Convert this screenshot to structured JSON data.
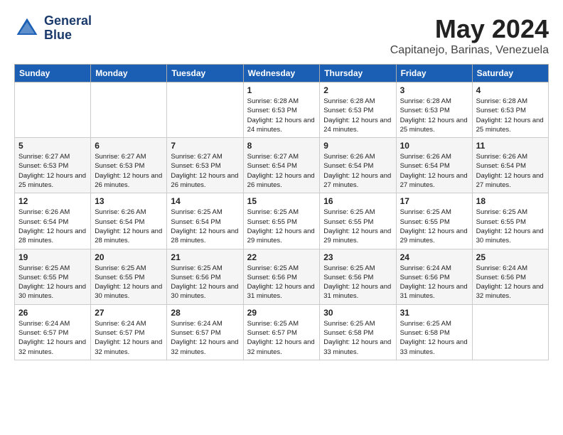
{
  "logo": {
    "line1": "General",
    "line2": "Blue"
  },
  "title": "May 2024",
  "location": "Capitanejo, Barinas, Venezuela",
  "weekdays": [
    "Sunday",
    "Monday",
    "Tuesday",
    "Wednesday",
    "Thursday",
    "Friday",
    "Saturday"
  ],
  "weeks": [
    [
      {
        "day": "",
        "sunrise": "",
        "sunset": "",
        "daylight": ""
      },
      {
        "day": "",
        "sunrise": "",
        "sunset": "",
        "daylight": ""
      },
      {
        "day": "",
        "sunrise": "",
        "sunset": "",
        "daylight": ""
      },
      {
        "day": "1",
        "sunrise": "Sunrise: 6:28 AM",
        "sunset": "Sunset: 6:53 PM",
        "daylight": "Daylight: 12 hours and 24 minutes."
      },
      {
        "day": "2",
        "sunrise": "Sunrise: 6:28 AM",
        "sunset": "Sunset: 6:53 PM",
        "daylight": "Daylight: 12 hours and 24 minutes."
      },
      {
        "day": "3",
        "sunrise": "Sunrise: 6:28 AM",
        "sunset": "Sunset: 6:53 PM",
        "daylight": "Daylight: 12 hours and 25 minutes."
      },
      {
        "day": "4",
        "sunrise": "Sunrise: 6:28 AM",
        "sunset": "Sunset: 6:53 PM",
        "daylight": "Daylight: 12 hours and 25 minutes."
      }
    ],
    [
      {
        "day": "5",
        "sunrise": "Sunrise: 6:27 AM",
        "sunset": "Sunset: 6:53 PM",
        "daylight": "Daylight: 12 hours and 25 minutes."
      },
      {
        "day": "6",
        "sunrise": "Sunrise: 6:27 AM",
        "sunset": "Sunset: 6:53 PM",
        "daylight": "Daylight: 12 hours and 26 minutes."
      },
      {
        "day": "7",
        "sunrise": "Sunrise: 6:27 AM",
        "sunset": "Sunset: 6:53 PM",
        "daylight": "Daylight: 12 hours and 26 minutes."
      },
      {
        "day": "8",
        "sunrise": "Sunrise: 6:27 AM",
        "sunset": "Sunset: 6:54 PM",
        "daylight": "Daylight: 12 hours and 26 minutes."
      },
      {
        "day": "9",
        "sunrise": "Sunrise: 6:26 AM",
        "sunset": "Sunset: 6:54 PM",
        "daylight": "Daylight: 12 hours and 27 minutes."
      },
      {
        "day": "10",
        "sunrise": "Sunrise: 6:26 AM",
        "sunset": "Sunset: 6:54 PM",
        "daylight": "Daylight: 12 hours and 27 minutes."
      },
      {
        "day": "11",
        "sunrise": "Sunrise: 6:26 AM",
        "sunset": "Sunset: 6:54 PM",
        "daylight": "Daylight: 12 hours and 27 minutes."
      }
    ],
    [
      {
        "day": "12",
        "sunrise": "Sunrise: 6:26 AM",
        "sunset": "Sunset: 6:54 PM",
        "daylight": "Daylight: 12 hours and 28 minutes."
      },
      {
        "day": "13",
        "sunrise": "Sunrise: 6:26 AM",
        "sunset": "Sunset: 6:54 PM",
        "daylight": "Daylight: 12 hours and 28 minutes."
      },
      {
        "day": "14",
        "sunrise": "Sunrise: 6:25 AM",
        "sunset": "Sunset: 6:54 PM",
        "daylight": "Daylight: 12 hours and 28 minutes."
      },
      {
        "day": "15",
        "sunrise": "Sunrise: 6:25 AM",
        "sunset": "Sunset: 6:55 PM",
        "daylight": "Daylight: 12 hours and 29 minutes."
      },
      {
        "day": "16",
        "sunrise": "Sunrise: 6:25 AM",
        "sunset": "Sunset: 6:55 PM",
        "daylight": "Daylight: 12 hours and 29 minutes."
      },
      {
        "day": "17",
        "sunrise": "Sunrise: 6:25 AM",
        "sunset": "Sunset: 6:55 PM",
        "daylight": "Daylight: 12 hours and 29 minutes."
      },
      {
        "day": "18",
        "sunrise": "Sunrise: 6:25 AM",
        "sunset": "Sunset: 6:55 PM",
        "daylight": "Daylight: 12 hours and 30 minutes."
      }
    ],
    [
      {
        "day": "19",
        "sunrise": "Sunrise: 6:25 AM",
        "sunset": "Sunset: 6:55 PM",
        "daylight": "Daylight: 12 hours and 30 minutes."
      },
      {
        "day": "20",
        "sunrise": "Sunrise: 6:25 AM",
        "sunset": "Sunset: 6:55 PM",
        "daylight": "Daylight: 12 hours and 30 minutes."
      },
      {
        "day": "21",
        "sunrise": "Sunrise: 6:25 AM",
        "sunset": "Sunset: 6:56 PM",
        "daylight": "Daylight: 12 hours and 30 minutes."
      },
      {
        "day": "22",
        "sunrise": "Sunrise: 6:25 AM",
        "sunset": "Sunset: 6:56 PM",
        "daylight": "Daylight: 12 hours and 31 minutes."
      },
      {
        "day": "23",
        "sunrise": "Sunrise: 6:25 AM",
        "sunset": "Sunset: 6:56 PM",
        "daylight": "Daylight: 12 hours and 31 minutes."
      },
      {
        "day": "24",
        "sunrise": "Sunrise: 6:24 AM",
        "sunset": "Sunset: 6:56 PM",
        "daylight": "Daylight: 12 hours and 31 minutes."
      },
      {
        "day": "25",
        "sunrise": "Sunrise: 6:24 AM",
        "sunset": "Sunset: 6:56 PM",
        "daylight": "Daylight: 12 hours and 32 minutes."
      }
    ],
    [
      {
        "day": "26",
        "sunrise": "Sunrise: 6:24 AM",
        "sunset": "Sunset: 6:57 PM",
        "daylight": "Daylight: 12 hours and 32 minutes."
      },
      {
        "day": "27",
        "sunrise": "Sunrise: 6:24 AM",
        "sunset": "Sunset: 6:57 PM",
        "daylight": "Daylight: 12 hours and 32 minutes."
      },
      {
        "day": "28",
        "sunrise": "Sunrise: 6:24 AM",
        "sunset": "Sunset: 6:57 PM",
        "daylight": "Daylight: 12 hours and 32 minutes."
      },
      {
        "day": "29",
        "sunrise": "Sunrise: 6:25 AM",
        "sunset": "Sunset: 6:57 PM",
        "daylight": "Daylight: 12 hours and 32 minutes."
      },
      {
        "day": "30",
        "sunrise": "Sunrise: 6:25 AM",
        "sunset": "Sunset: 6:58 PM",
        "daylight": "Daylight: 12 hours and 33 minutes."
      },
      {
        "day": "31",
        "sunrise": "Sunrise: 6:25 AM",
        "sunset": "Sunset: 6:58 PM",
        "daylight": "Daylight: 12 hours and 33 minutes."
      },
      {
        "day": "",
        "sunrise": "",
        "sunset": "",
        "daylight": ""
      }
    ]
  ]
}
